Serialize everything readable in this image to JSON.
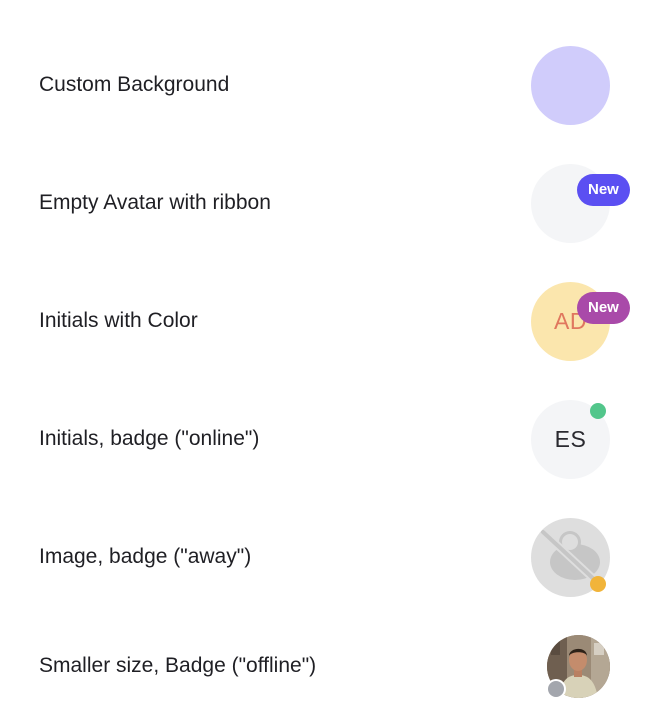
{
  "rows": [
    {
      "label": "Custom Background",
      "avatar_bg": "#d0ccfb"
    },
    {
      "label": "Empty Avatar with ribbon",
      "avatar_bg": "#f4f5f7",
      "ribbon": "New",
      "ribbon_color": "#5b4ff2"
    },
    {
      "label": "Initials with Color",
      "avatar_bg": "#fbe6ad",
      "initials": "AD",
      "initials_color": "#e0775e",
      "ribbon": "New",
      "ribbon_color": "#a94aa9"
    },
    {
      "label": "Initials, badge (\"online\")",
      "avatar_bg": "#f4f5f7",
      "initials": "ES",
      "initials_color": "#2a2a30",
      "badge": "online",
      "badge_color": "#52c68b"
    },
    {
      "label": "Image, badge (\"away\")",
      "avatar_bg": "#dedede",
      "icon": "image-off-icon",
      "badge": "away",
      "badge_color": "#f1b43a"
    },
    {
      "label": "Smaller size, Badge (\"offline\")",
      "avatar": "person-photo",
      "badge": "offline",
      "badge_color": "#a3a6ad"
    }
  ]
}
